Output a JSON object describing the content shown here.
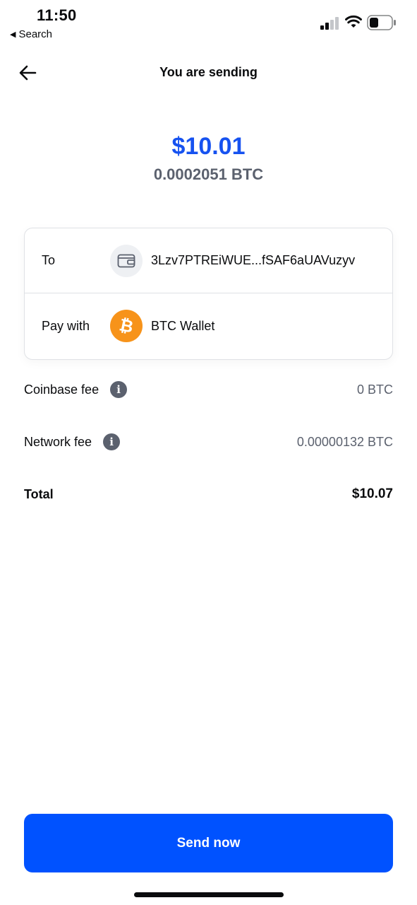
{
  "status_bar": {
    "time": "11:50",
    "back_app_label": "Search"
  },
  "header": {
    "title": "You are sending"
  },
  "amount": {
    "fiat": "$10.01",
    "crypto": "0.0002051 BTC",
    "accent_color": "#1652f0"
  },
  "details": {
    "to": {
      "label": "To",
      "icon": "wallet-icon",
      "value": "3Lzv7PTREiWUE...fSAF6aUAVuzyv"
    },
    "pay_with": {
      "label": "Pay with",
      "icon": "bitcoin-icon",
      "value": "BTC Wallet",
      "icon_color": "#f7931a"
    }
  },
  "fees": {
    "coinbase_fee": {
      "label": "Coinbase fee",
      "value": "0 BTC",
      "icon": "info-icon"
    },
    "network_fee": {
      "label": "Network fee",
      "value": "0.00000132 BTC",
      "icon": "info-icon"
    }
  },
  "total": {
    "label": "Total",
    "value": "$10.07"
  },
  "actions": {
    "send_label": "Send now",
    "button_color": "#0052ff"
  }
}
